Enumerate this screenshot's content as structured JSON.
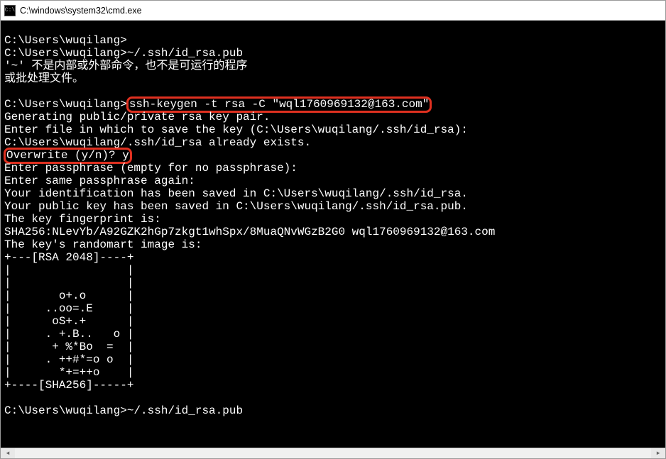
{
  "titlebar": {
    "icon_label": "C:\\",
    "title": "C:\\windows\\system32\\cmd.exe"
  },
  "console": {
    "line1_prompt": "C:\\Users\\wuqilang>",
    "line2": "C:\\Users\\wuqilang>~/.ssh/id_rsa.pub",
    "line3": "'~' 不是内部或外部命令，也不是可运行的程序",
    "line4": "或批处理文件。",
    "blank": "",
    "line5_prompt": "C:\\Users\\wuqilang>",
    "line5_cmd": "ssh-keygen -t rsa -C \"wql1760969132@163.com\"",
    "line6": "Generating public/private rsa key pair.",
    "line7": "Enter file in which to save the key (C:\\Users\\wuqilang/.ssh/id_rsa):",
    "line8": "C:\\Users\\wuqilang/.ssh/id_rsa already exists.",
    "line9_hl": "Overwrite (y/n)? y",
    "line10": "Enter passphrase (empty for no passphrase):",
    "line11": "Enter same passphrase again:",
    "line12": "Your identification has been saved in C:\\Users\\wuqilang/.ssh/id_rsa.",
    "line13": "Your public key has been saved in C:\\Users\\wuqilang/.ssh/id_rsa.pub.",
    "line14": "The key fingerprint is:",
    "line15": "SHA256:NLevYb/A92GZK2hGp7zkgt1whSpx/8MuaQNvWGzB2G0 wql1760969132@163.com",
    "line16": "The key's randomart image is:",
    "art1": "+---[RSA 2048]----+",
    "art2": "|                 |",
    "art3": "|                 |",
    "art4": "|       o+.o      |",
    "art5": "|     ..oo=.E     |",
    "art6": "|      oS+.+      |",
    "art7": "|     . +.B..   o |",
    "art8": "|      + %*Bo  =  |",
    "art9": "|     . ++#*=o o  |",
    "art10": "|       *+=++o    |",
    "art11": "+----[SHA256]-----+",
    "line_last": "C:\\Users\\wuqilang>~/.ssh/id_rsa.pub"
  }
}
